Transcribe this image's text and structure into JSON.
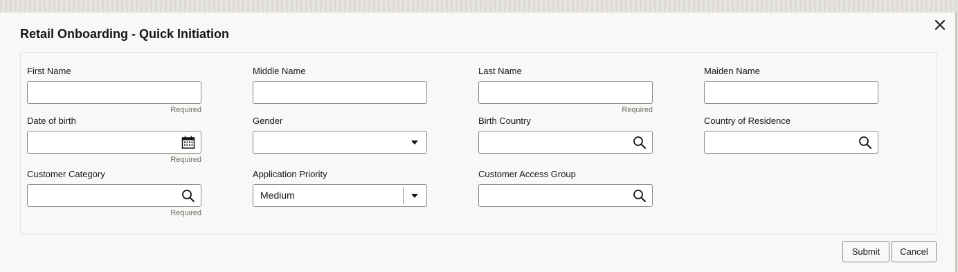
{
  "dialog": {
    "title": "Retail Onboarding - Quick Initiation"
  },
  "fields": {
    "first_name": {
      "label": "First Name",
      "value": "",
      "hint": "Required"
    },
    "middle_name": {
      "label": "Middle Name",
      "value": ""
    },
    "last_name": {
      "label": "Last Name",
      "value": "",
      "hint": "Required"
    },
    "maiden_name": {
      "label": "Maiden Name",
      "value": ""
    },
    "date_of_birth": {
      "label": "Date of birth",
      "value": "",
      "hint": "Required",
      "icon": "calendar-icon"
    },
    "gender": {
      "label": "Gender",
      "value": "",
      "icon": "chevron-down-icon"
    },
    "birth_country": {
      "label": "Birth Country",
      "value": "",
      "icon": "search-icon"
    },
    "country_of_residence": {
      "label": "Country of Residence",
      "value": "",
      "icon": "search-icon"
    },
    "customer_category": {
      "label": "Customer Category",
      "value": "",
      "hint": "Required",
      "icon": "search-icon"
    },
    "application_priority": {
      "label": "Application Priority",
      "value": "Medium",
      "icon": "chevron-down-icon"
    },
    "customer_access_group": {
      "label": "Customer Access Group",
      "value": "",
      "icon": "search-icon"
    }
  },
  "actions": {
    "submit_label": "Submit",
    "cancel_label": "Cancel"
  },
  "colors": {
    "background": "#f9f8f7",
    "border": "#8c8883",
    "text": "#161513",
    "hint": "#6f6b66"
  }
}
